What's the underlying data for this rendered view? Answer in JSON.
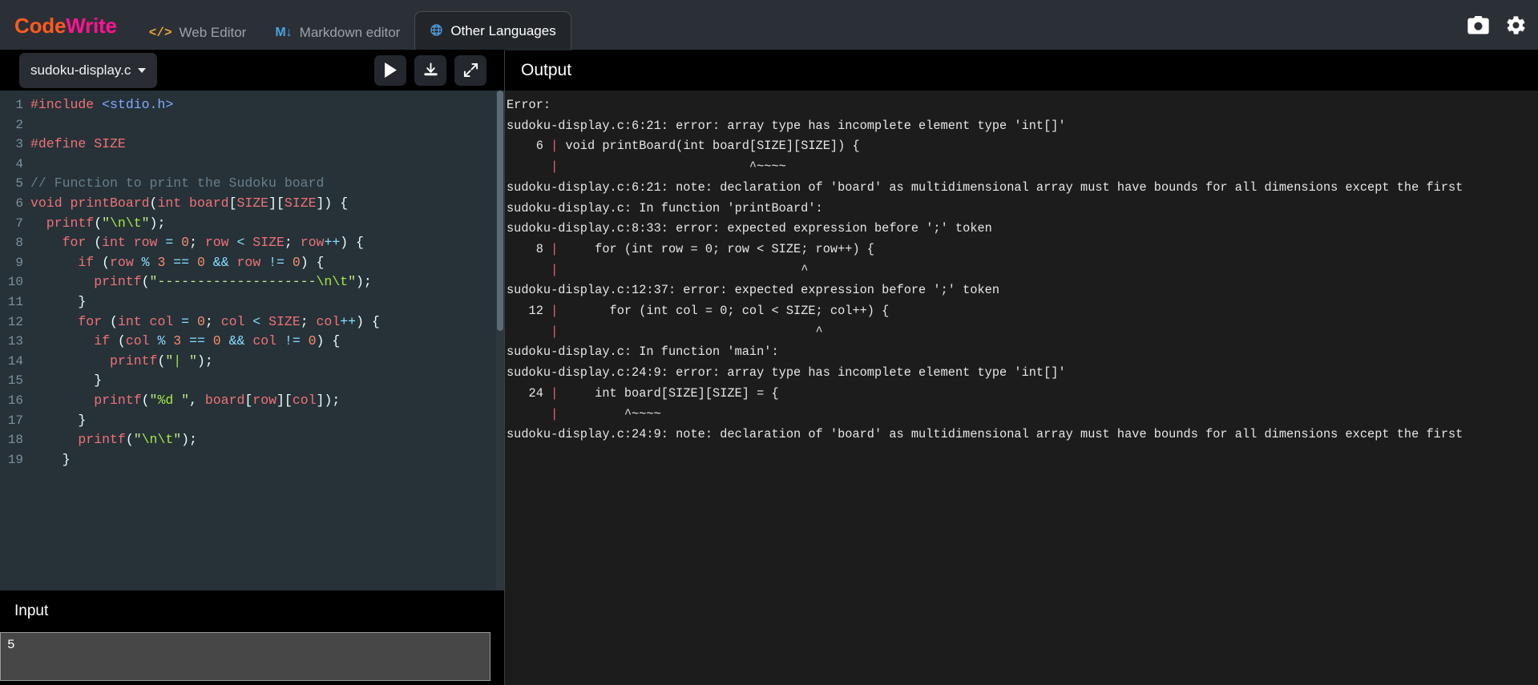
{
  "brand": {
    "part1": "Code",
    "part2": "Write"
  },
  "nav": {
    "tabs": [
      {
        "icon": "code-brackets-icon",
        "glyph": "</>",
        "label": "Web Editor",
        "active": false
      },
      {
        "icon": "markdown-icon",
        "glyph": "M↓",
        "label": "Markdown editor",
        "active": false
      },
      {
        "icon": "globe-icon",
        "glyph": "ἱ0",
        "label": "Other Languages",
        "active": true
      }
    ],
    "right_icons": [
      {
        "name": "camera-icon",
        "label": "Screenshot"
      },
      {
        "name": "gear-icon",
        "label": "Settings"
      }
    ]
  },
  "editor": {
    "filename": "sudoku-display.c",
    "buttons": [
      {
        "name": "run-button",
        "label": "Run"
      },
      {
        "name": "download-button",
        "label": "Download"
      },
      {
        "name": "fullscreen-button",
        "label": "Expand"
      }
    ],
    "lines": [
      {
        "n": 1,
        "tokens": [
          {
            "c": "t-key",
            "t": "#include"
          },
          {
            "c": "t-pun",
            "t": " "
          },
          {
            "c": "t-inc",
            "t": "<stdio.h>"
          }
        ]
      },
      {
        "n": 2,
        "tokens": []
      },
      {
        "n": 3,
        "tokens": [
          {
            "c": "t-key",
            "t": "#define SIZE"
          }
        ]
      },
      {
        "n": 4,
        "tokens": []
      },
      {
        "n": 5,
        "tokens": [
          {
            "c": "t-com",
            "t": "// Function to print the Sudoku board"
          }
        ]
      },
      {
        "n": 6,
        "tokens": [
          {
            "c": "t-key",
            "t": "void printBoard"
          },
          {
            "c": "t-pun",
            "t": "("
          },
          {
            "c": "t-key",
            "t": "int board"
          },
          {
            "c": "t-pun",
            "t": "["
          },
          {
            "c": "t-key",
            "t": "SIZE"
          },
          {
            "c": "t-pun",
            "t": "]["
          },
          {
            "c": "t-key",
            "t": "SIZE"
          },
          {
            "c": "t-pun",
            "t": "]) {"
          }
        ]
      },
      {
        "n": 7,
        "tokens": [
          {
            "c": "t-plain",
            "t": "  printf"
          },
          {
            "c": "t-pun",
            "t": "("
          },
          {
            "c": "t-str",
            "t": "\""
          },
          {
            "c": "t-esc",
            "t": "\\n\\t"
          },
          {
            "c": "t-str",
            "t": "\""
          },
          {
            "c": "t-pun",
            "t": ");"
          }
        ]
      },
      {
        "n": 8,
        "tokens": [
          {
            "c": "t-key",
            "t": "    for "
          },
          {
            "c": "t-pun",
            "t": "("
          },
          {
            "c": "t-key",
            "t": "int row "
          },
          {
            "c": "t-op",
            "t": "= "
          },
          {
            "c": "t-num",
            "t": "0"
          },
          {
            "c": "t-pun",
            "t": "; "
          },
          {
            "c": "t-key",
            "t": "row "
          },
          {
            "c": "t-op",
            "t": "< "
          },
          {
            "c": "t-key",
            "t": "SIZE"
          },
          {
            "c": "t-pun",
            "t": "; "
          },
          {
            "c": "t-key",
            "t": "row"
          },
          {
            "c": "t-op",
            "t": "++"
          },
          {
            "c": "t-pun",
            "t": ") {"
          }
        ]
      },
      {
        "n": 9,
        "tokens": [
          {
            "c": "t-key",
            "t": "      if "
          },
          {
            "c": "t-pun",
            "t": "("
          },
          {
            "c": "t-key",
            "t": "row "
          },
          {
            "c": "t-op",
            "t": "% "
          },
          {
            "c": "t-num",
            "t": "3 "
          },
          {
            "c": "t-op",
            "t": "== "
          },
          {
            "c": "t-num",
            "t": "0 "
          },
          {
            "c": "t-op",
            "t": "&& "
          },
          {
            "c": "t-key",
            "t": "row "
          },
          {
            "c": "t-op",
            "t": "!= "
          },
          {
            "c": "t-num",
            "t": "0"
          },
          {
            "c": "t-pun",
            "t": ") {"
          }
        ]
      },
      {
        "n": 10,
        "tokens": [
          {
            "c": "t-plain",
            "t": "        printf"
          },
          {
            "c": "t-pun",
            "t": "("
          },
          {
            "c": "t-str",
            "t": "\"--------------------"
          },
          {
            "c": "t-esc",
            "t": "\\n\\t"
          },
          {
            "c": "t-str",
            "t": "\""
          },
          {
            "c": "t-pun",
            "t": ");"
          }
        ]
      },
      {
        "n": 11,
        "tokens": [
          {
            "c": "t-pun",
            "t": "      }"
          }
        ]
      },
      {
        "n": 12,
        "tokens": [
          {
            "c": "t-key",
            "t": "      for "
          },
          {
            "c": "t-pun",
            "t": "("
          },
          {
            "c": "t-key",
            "t": "int col "
          },
          {
            "c": "t-op",
            "t": "= "
          },
          {
            "c": "t-num",
            "t": "0"
          },
          {
            "c": "t-pun",
            "t": "; "
          },
          {
            "c": "t-key",
            "t": "col "
          },
          {
            "c": "t-op",
            "t": "< "
          },
          {
            "c": "t-key",
            "t": "SIZE"
          },
          {
            "c": "t-pun",
            "t": "; "
          },
          {
            "c": "t-key",
            "t": "col"
          },
          {
            "c": "t-op",
            "t": "++"
          },
          {
            "c": "t-pun",
            "t": ") {"
          }
        ]
      },
      {
        "n": 13,
        "tokens": [
          {
            "c": "t-key",
            "t": "        if "
          },
          {
            "c": "t-pun",
            "t": "("
          },
          {
            "c": "t-key",
            "t": "col "
          },
          {
            "c": "t-op",
            "t": "% "
          },
          {
            "c": "t-num",
            "t": "3 "
          },
          {
            "c": "t-op",
            "t": "== "
          },
          {
            "c": "t-num",
            "t": "0 "
          },
          {
            "c": "t-op",
            "t": "&& "
          },
          {
            "c": "t-key",
            "t": "col "
          },
          {
            "c": "t-op",
            "t": "!= "
          },
          {
            "c": "t-num",
            "t": "0"
          },
          {
            "c": "t-pun",
            "t": ") {"
          }
        ]
      },
      {
        "n": 14,
        "tokens": [
          {
            "c": "t-plain",
            "t": "          printf"
          },
          {
            "c": "t-pun",
            "t": "("
          },
          {
            "c": "t-str",
            "t": "\""
          },
          {
            "c": "t-esc",
            "t": "|"
          },
          {
            "c": "t-str",
            "t": " \""
          },
          {
            "c": "t-pun",
            "t": ");"
          }
        ]
      },
      {
        "n": 15,
        "tokens": [
          {
            "c": "t-pun",
            "t": "        }"
          }
        ]
      },
      {
        "n": 16,
        "tokens": [
          {
            "c": "t-plain",
            "t": "        printf"
          },
          {
            "c": "t-pun",
            "t": "("
          },
          {
            "c": "t-str",
            "t": "\""
          },
          {
            "c": "t-esc",
            "t": "%d"
          },
          {
            "c": "t-str",
            "t": " \""
          },
          {
            "c": "t-pun",
            "t": ", "
          },
          {
            "c": "t-key",
            "t": "board"
          },
          {
            "c": "t-pun",
            "t": "["
          },
          {
            "c": "t-key",
            "t": "row"
          },
          {
            "c": "t-pun",
            "t": "]["
          },
          {
            "c": "t-key",
            "t": "col"
          },
          {
            "c": "t-pun",
            "t": "]);"
          }
        ]
      },
      {
        "n": 17,
        "tokens": [
          {
            "c": "t-pun",
            "t": "      }"
          }
        ]
      },
      {
        "n": 18,
        "tokens": [
          {
            "c": "t-plain",
            "t": "      printf"
          },
          {
            "c": "t-pun",
            "t": "("
          },
          {
            "c": "t-str",
            "t": "\""
          },
          {
            "c": "t-esc",
            "t": "\\n\\t"
          },
          {
            "c": "t-str",
            "t": "\""
          },
          {
            "c": "t-pun",
            "t": ");"
          }
        ]
      },
      {
        "n": 19,
        "tokens": [
          {
            "c": "t-pun",
            "t": "    }"
          }
        ]
      }
    ]
  },
  "input": {
    "title": "Input",
    "value": "5",
    "placeholder": ""
  },
  "output": {
    "title": "Output",
    "lines": [
      "Error:",
      "sudoku-display.c:6:21: error: array type has incomplete element type 'int[]'",
      "    6 | void printBoard(int board[SIZE][SIZE]) {",
      "      |                          ^~~~~",
      "sudoku-display.c:6:21: note: declaration of 'board' as multidimensional array must have bounds for all dimensions except the first",
      "sudoku-display.c: In function 'printBoard':",
      "sudoku-display.c:8:33: error: expected expression before ';' token",
      "    8 |     for (int row = 0; row < SIZE; row++) {",
      "      |                                 ^",
      "sudoku-display.c:12:37: error: expected expression before ';' token",
      "   12 |       for (int col = 0; col < SIZE; col++) {",
      "      |                                   ^",
      "sudoku-display.c: In function 'main':",
      "sudoku-display.c:24:9: error: array type has incomplete element type 'int[]'",
      "   24 |     int board[SIZE][SIZE] = {",
      "      |         ^~~~~",
      "sudoku-display.c:24:9: note: declaration of 'board' as multidimensional array must have bounds for all dimensions except the first"
    ]
  },
  "colors": {
    "brand_orange": "#ff5a1f",
    "brand_pink": "#ff1493",
    "navbar_bg": "#2b3036",
    "editor_bg": "#263238",
    "output_bg": "#1c1c1c",
    "panel_black": "#000000",
    "input_bg": "#474747"
  }
}
